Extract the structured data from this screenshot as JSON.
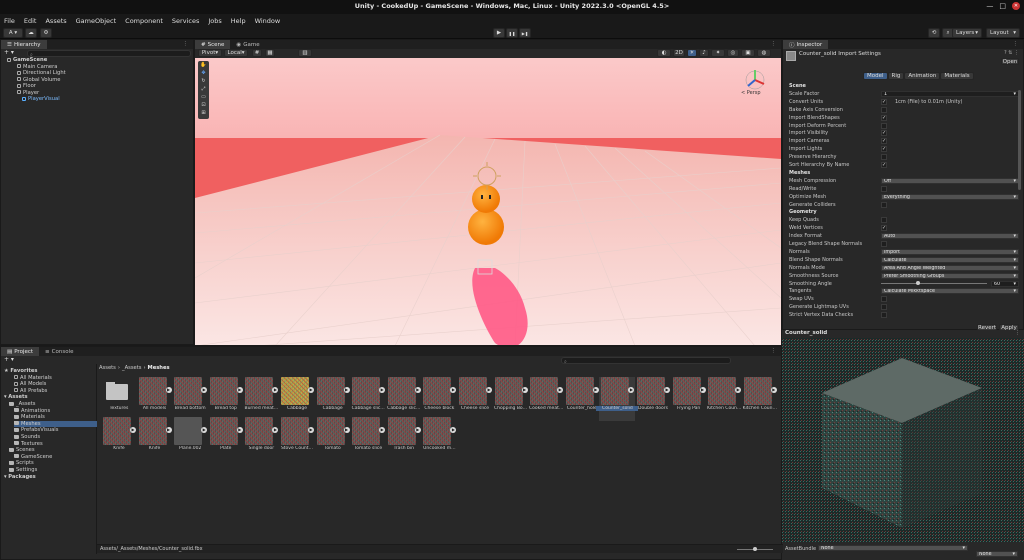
{
  "window": {
    "title": "Unity - CookedUp - GameScene - Windows, Mac, Linux - Unity 2022.3.0 <OpenGL 4.5>",
    "minimize": "—",
    "maximize": "□",
    "close": "✕"
  },
  "menu": [
    "File",
    "Edit",
    "Assets",
    "GameObject",
    "Component",
    "Services",
    "Jobs",
    "Help",
    "Window"
  ],
  "toolbar": {
    "account": "A ▾",
    "cloud": "☁",
    "layers": "Layers",
    "layout": "Layout",
    "play": "▶",
    "pause": "❚❚",
    "step": "▶❚"
  },
  "hierarchy": {
    "tab": "Hierarchy",
    "add": "+ ▾",
    "items": [
      {
        "label": "GameScene",
        "depth": 0,
        "bold": true
      },
      {
        "label": "Main Camera",
        "depth": 2
      },
      {
        "label": "Directional Light",
        "depth": 2
      },
      {
        "label": "Global Volume",
        "depth": 2
      },
      {
        "label": "Floor",
        "depth": 2
      },
      {
        "label": "Player",
        "depth": 2
      },
      {
        "label": "PlayerVisual",
        "depth": 3,
        "prefab": true
      }
    ]
  },
  "scene": {
    "tabs": [
      "Scene",
      "Game"
    ],
    "pivot": "Pivot",
    "local": "Local",
    "twod": "2D",
    "persp": "< Persp"
  },
  "inspector": {
    "tab": "Inspector",
    "title": "Counter_solid Import Settings",
    "open": "Open",
    "tabs": [
      "Model",
      "Rig",
      "Animation",
      "Materials"
    ],
    "rows": [
      {
        "type": "section",
        "label": "Scene"
      },
      {
        "type": "field",
        "label": "Scale Factor",
        "value": "1"
      },
      {
        "type": "check",
        "label": "Convert Units",
        "checked": true,
        "note": "1cm (File) to 0.01m (Unity)"
      },
      {
        "type": "check",
        "label": "Bake Axis Conversion",
        "checked": false
      },
      {
        "type": "check",
        "label": "Import BlendShapes",
        "checked": true
      },
      {
        "type": "check",
        "label": "Import Deform Percent",
        "checked": false
      },
      {
        "type": "check",
        "label": "Import Visibility",
        "checked": true
      },
      {
        "type": "check",
        "label": "Import Cameras",
        "checked": true
      },
      {
        "type": "check",
        "label": "Import Lights",
        "checked": true
      },
      {
        "type": "check",
        "label": "Preserve Hierarchy",
        "checked": false
      },
      {
        "type": "check",
        "label": "Sort Hierarchy By Name",
        "checked": true
      },
      {
        "type": "section",
        "label": "Meshes"
      },
      {
        "type": "dropdown",
        "label": "Mesh Compression",
        "value": "Off"
      },
      {
        "type": "check",
        "label": "Read/Write",
        "checked": false
      },
      {
        "type": "dropdown",
        "label": "Optimize Mesh",
        "value": "Everything"
      },
      {
        "type": "check",
        "label": "Generate Colliders",
        "checked": false
      },
      {
        "type": "section",
        "label": "Geometry"
      },
      {
        "type": "check",
        "label": "Keep Quads",
        "checked": false
      },
      {
        "type": "check",
        "label": "Weld Vertices",
        "checked": true
      },
      {
        "type": "dropdown",
        "label": "Index Format",
        "value": "Auto"
      },
      {
        "type": "check",
        "label": "Legacy Blend Shape Normals",
        "checked": false
      },
      {
        "type": "dropdown",
        "label": "Normals",
        "value": "Import"
      },
      {
        "type": "dropdown",
        "label": "Blend Shape Normals",
        "value": "Calculate"
      },
      {
        "type": "dropdown",
        "label": "Normals Mode",
        "value": "Area And Angle Weighted"
      },
      {
        "type": "dropdown",
        "label": "Smoothness Source",
        "value": "Prefer Smoothing Groups"
      },
      {
        "type": "slider",
        "label": "Smoothing Angle",
        "value": "60",
        "fraction": 0.33
      },
      {
        "type": "dropdown",
        "label": "Tangents",
        "value": "Calculate Mikktspace"
      },
      {
        "type": "check",
        "label": "Swap UVs",
        "checked": false
      },
      {
        "type": "check",
        "label": "Generate Lightmap UVs",
        "checked": false
      },
      {
        "type": "check",
        "label": "Strict Vertex Data Checks",
        "checked": false
      }
    ],
    "revert": "Revert",
    "apply": "Apply"
  },
  "preview": {
    "title": "Counter_solid",
    "assetbundle_label": "AssetBundle",
    "bundle": "None",
    "variant": "None"
  },
  "project": {
    "tabs": [
      "Project",
      "Console"
    ],
    "add": "+ ▾",
    "breadcrumb": [
      "Assets",
      "_Assets",
      "Meshes"
    ],
    "tree": [
      {
        "label": "Favorites",
        "depth": 0,
        "bold": true,
        "star": true
      },
      {
        "label": "All Materials",
        "depth": 2
      },
      {
        "label": "All Models",
        "depth": 2
      },
      {
        "label": "All Prefabs",
        "depth": 2
      },
      {
        "label": "Assets",
        "depth": 0,
        "bold": true
      },
      {
        "label": "_Assets",
        "depth": 1
      },
      {
        "label": "Animations",
        "depth": 2
      },
      {
        "label": "Materials",
        "depth": 2
      },
      {
        "label": "Meshes",
        "depth": 2,
        "selected": true
      },
      {
        "label": "PrefabsVisuals",
        "depth": 2
      },
      {
        "label": "Sounds",
        "depth": 2
      },
      {
        "label": "Textures",
        "depth": 2
      },
      {
        "label": "Scenes",
        "depth": 1
      },
      {
        "label": "GameScene",
        "depth": 2
      },
      {
        "label": "Scripts",
        "depth": 1
      },
      {
        "label": "Settings",
        "depth": 1
      },
      {
        "label": "Packages",
        "depth": 0,
        "bold": true
      }
    ],
    "assets_row1": [
      "Textures",
      "All models",
      "Bread bottom",
      "Bread top",
      "Burned meat…",
      "Cabbage",
      "Cabbage",
      "Cabbage slic…",
      "Cabbage slic…",
      "Cheese block",
      "Cheese slice",
      "Chopping Bo…",
      "Cooked meat…",
      "Counter_hole",
      "Counter_solid",
      "Double doors",
      "Frying Pan",
      "Kitchen Coun…",
      "Kitchen Coun…"
    ],
    "assets_row2": [
      "Knife",
      "Knife",
      "Plane.002",
      "Plate",
      "Single door",
      "Stove Count…",
      "Tomato",
      "Tomato slice",
      "Trash bin",
      "Uncooked m…"
    ],
    "status_path": "Assets/_Assets/Meshes/Counter_solid.fbx",
    "zoom": 0.5
  },
  "colors": {
    "accent": "#3e5f8a",
    "sky": "#f7a8a8",
    "floor": "#f1c9c6",
    "player": "#ff8c1a",
    "shadow": "#ff5a7a"
  }
}
